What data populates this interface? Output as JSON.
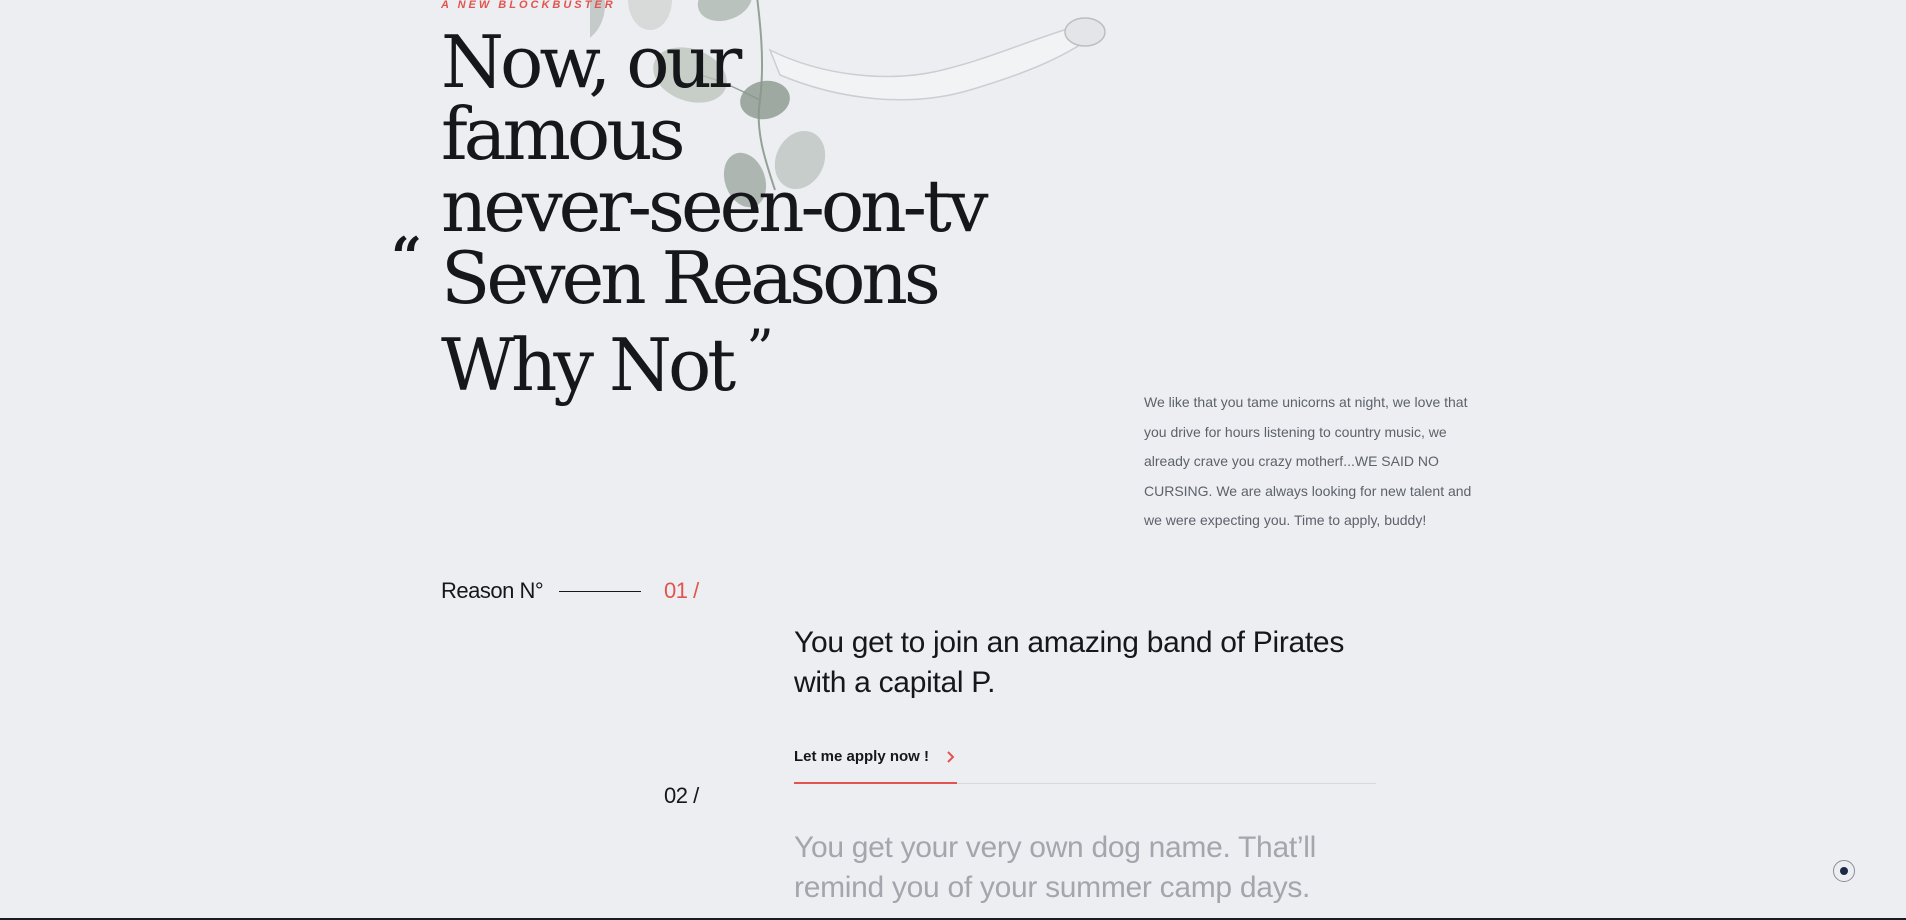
{
  "hero": {
    "eyebrow": "A NEW BLOCKBUSTER",
    "open_quote": "“",
    "headline_lines": [
      "Now, our",
      "famous",
      "never-seen-on-tv",
      "Seven Reasons",
      "Why Not"
    ],
    "close_quote": "”",
    "intro": "We like that you tame unicorns at night, we love that you drive for hours listening to country music, we already crave you crazy motherf...WE SAID NO CURSING. We are always looking for new talent and we were expecting you. Time to apply, buddy!",
    "art_icon": "leaves-and-arm-illustration"
  },
  "reasons": {
    "label": "Reason N°",
    "items": [
      {
        "number": "01 /",
        "text": "You get to join an amazing band of Pirates with a capital P."
      },
      {
        "number": "02 /",
        "text": "You get your very own dog name. That’ll remind you of your summer camp days."
      }
    ],
    "cta_label": "Let me apply now !",
    "cta_icon": "chevron-right-icon"
  },
  "scroll_indicator_icon": "scroll-dot-icon",
  "colors": {
    "background": "#eceef1",
    "accent": "#e3534f",
    "text": "#15171b",
    "muted": "#5d616b",
    "faded": "#a3a6ad"
  }
}
